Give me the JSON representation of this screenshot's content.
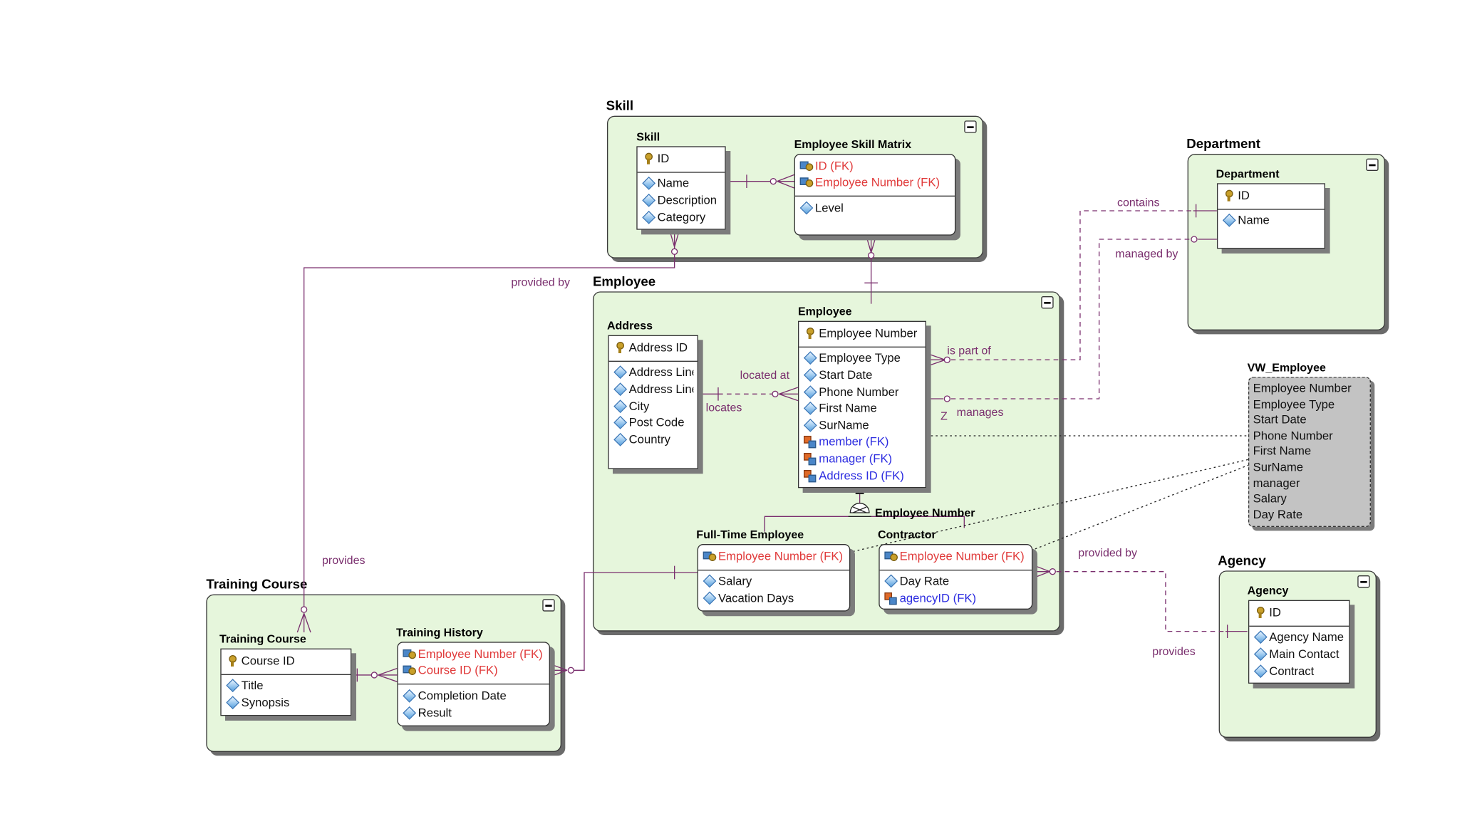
{
  "colors": {
    "area_fill": "#e6f6dc",
    "relationship_line": "#7a2f6e",
    "fk_identifying": "#e03a3a",
    "fk_non_identifying": "#2c2ce0",
    "view_fill": "#c3c3c3"
  },
  "areas": {
    "skill": {
      "title": "Skill"
    },
    "employee": {
      "title": "Employee"
    },
    "department": {
      "title": "Department"
    },
    "training": {
      "title": "Training Course"
    },
    "agency": {
      "title": "Agency"
    }
  },
  "entities": {
    "skill": {
      "title": "Skill",
      "pk": [
        {
          "icon": "primary-key-icon",
          "label": "ID"
        }
      ],
      "attrs": [
        {
          "icon": "attribute-icon",
          "label": "Name"
        },
        {
          "icon": "attribute-icon",
          "label": "Description"
        },
        {
          "icon": "attribute-icon",
          "label": "Category"
        }
      ]
    },
    "skill_matrix": {
      "title": "Employee Skill Matrix",
      "pk": [
        {
          "icon": "foreign-primary-key-icon",
          "label": "ID (FK)"
        },
        {
          "icon": "foreign-primary-key-icon",
          "label": "Employee Number (FK)"
        }
      ],
      "attrs": [
        {
          "icon": "attribute-icon",
          "label": "Level"
        }
      ]
    },
    "address": {
      "title": "Address",
      "pk": [
        {
          "icon": "primary-key-icon",
          "label": "Address ID"
        }
      ],
      "attrs": [
        {
          "icon": "attribute-icon",
          "label": "Address Line"
        },
        {
          "icon": "attribute-icon",
          "label": "Address Line"
        },
        {
          "icon": "attribute-icon",
          "label": "City"
        },
        {
          "icon": "attribute-icon",
          "label": "Post Code"
        },
        {
          "icon": "attribute-icon",
          "label": "Country"
        }
      ]
    },
    "employee": {
      "title": "Employee",
      "pk": [
        {
          "icon": "primary-key-icon",
          "label": "Employee Number"
        }
      ],
      "attrs": [
        {
          "icon": "attribute-icon",
          "label": "Employee Type"
        },
        {
          "icon": "attribute-icon",
          "label": "Start Date"
        },
        {
          "icon": "attribute-icon",
          "label": "Phone Number"
        },
        {
          "icon": "attribute-icon",
          "label": "First Name"
        },
        {
          "icon": "attribute-icon",
          "label": "SurName"
        },
        {
          "icon": "foreign-key-icon",
          "label": "member (FK)"
        },
        {
          "icon": "foreign-key-icon",
          "label": "manager (FK)"
        },
        {
          "icon": "foreign-key-icon",
          "label": "Address ID (FK)"
        }
      ]
    },
    "fulltime": {
      "title": "Full-Time Employee",
      "pk": [
        {
          "icon": "foreign-primary-key-icon",
          "label": "Employee Number (FK)"
        }
      ],
      "attrs": [
        {
          "icon": "attribute-icon",
          "label": "Salary"
        },
        {
          "icon": "attribute-icon",
          "label": "Vacation Days"
        }
      ]
    },
    "contractor": {
      "title": "Contractor",
      "pk": [
        {
          "icon": "foreign-primary-key-icon",
          "label": "Employee Number (FK)"
        }
      ],
      "attrs": [
        {
          "icon": "attribute-icon",
          "label": "Day Rate"
        },
        {
          "icon": "foreign-key-icon",
          "label": "agencyID (FK)"
        }
      ]
    },
    "department": {
      "title": "Department",
      "pk": [
        {
          "icon": "primary-key-icon",
          "label": "ID"
        }
      ],
      "attrs": [
        {
          "icon": "attribute-icon",
          "label": "Name"
        }
      ]
    },
    "training_course": {
      "title": "Training Course",
      "pk": [
        {
          "icon": "primary-key-icon",
          "label": "Course ID"
        }
      ],
      "attrs": [
        {
          "icon": "attribute-icon",
          "label": "Title"
        },
        {
          "icon": "attribute-icon",
          "label": "Synopsis"
        }
      ]
    },
    "training_history": {
      "title": "Training History",
      "pk": [
        {
          "icon": "foreign-primary-key-icon",
          "label": "Employee Number (FK)"
        },
        {
          "icon": "foreign-primary-key-icon",
          "label": "Course ID (FK)"
        }
      ],
      "attrs": [
        {
          "icon": "attribute-icon",
          "label": "Completion Date"
        },
        {
          "icon": "attribute-icon",
          "label": "Result"
        }
      ]
    },
    "agency": {
      "title": "Agency",
      "pk": [
        {
          "icon": "primary-key-icon",
          "label": "ID"
        }
      ],
      "attrs": [
        {
          "icon": "attribute-icon",
          "label": "Agency Name"
        },
        {
          "icon": "attribute-icon",
          "label": "Main Contact"
        },
        {
          "icon": "attribute-icon",
          "label": "Contract"
        }
      ]
    }
  },
  "view": {
    "title": "VW_Employee",
    "columns": [
      "Employee Number",
      "Employee Type",
      "Start Date",
      "Phone Number",
      "First Name",
      "SurName",
      "manager",
      "Salary",
      "Day Rate"
    ]
  },
  "subtype_discriminator": "Employee Number",
  "relationship_labels": {
    "provided_by_skill": "provided by",
    "provides_training": "provides",
    "contains": "contains",
    "managed_by": "managed by",
    "is_part_of": "is part of",
    "manages": "manages",
    "manages_marker": "Z",
    "located_at": "located at",
    "locates": "locates",
    "provided_by_agency": "provided by",
    "provides_agency": "provides"
  }
}
